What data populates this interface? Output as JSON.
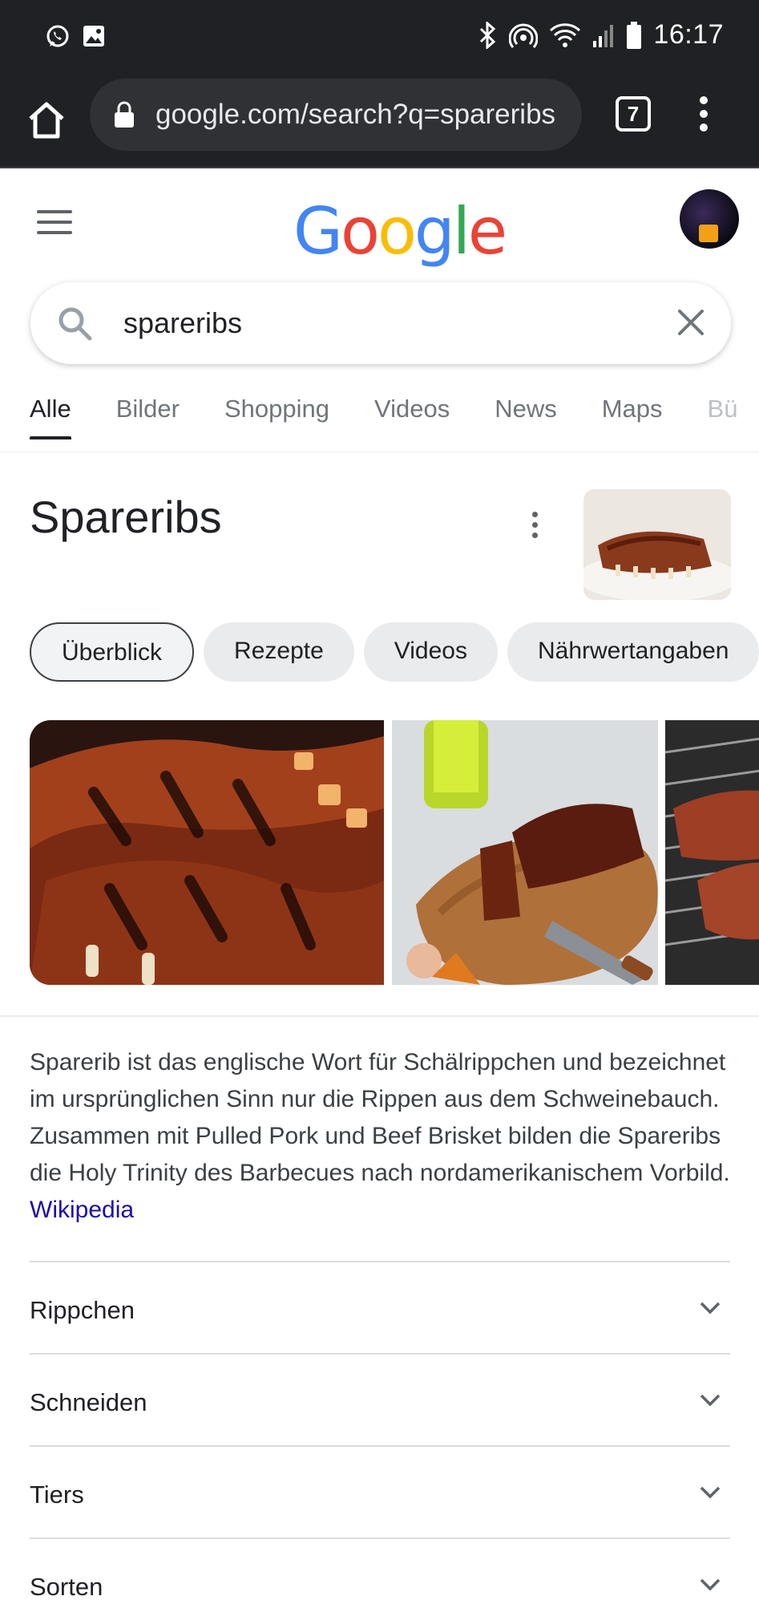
{
  "statusbar": {
    "time": "16:17"
  },
  "browser": {
    "url": "google.com/search?q=spareribs",
    "tab_count": "7"
  },
  "google": {
    "logo": "Google"
  },
  "search": {
    "query": "spareribs"
  },
  "nav_tabs": [
    {
      "label": "Alle"
    },
    {
      "label": "Bilder"
    },
    {
      "label": "Shopping"
    },
    {
      "label": "Videos"
    },
    {
      "label": "News"
    },
    {
      "label": "Maps"
    },
    {
      "label": "Bü"
    }
  ],
  "knowledge_panel": {
    "title": "Spareribs",
    "chips": [
      {
        "label": "Überblick"
      },
      {
        "label": "Rezepte"
      },
      {
        "label": "Videos"
      },
      {
        "label": "Nährwertangaben"
      }
    ],
    "description": "Sparerib ist das englische Wort für Schälrippchen und bezeichnet im ursprünglichen Sinn nur die Rippen aus dem Schweinebauch. Zusammen mit Pulled Pork und Beef Brisket bilden die Spareribs die Holy Trinity des Barbecues nach nordamerikanischem Vorbild.",
    "source": "Wikipedia",
    "sections": [
      {
        "label": "Rippchen"
      },
      {
        "label": "Schneiden"
      },
      {
        "label": "Tiers"
      },
      {
        "label": "Sorten"
      }
    ]
  },
  "colors": {
    "status_bg": "#202124",
    "link": "#1a0dab",
    "g_blue": "#4285F4",
    "g_red": "#EA4335",
    "g_yellow": "#FBBC05",
    "g_green": "#34A853"
  }
}
